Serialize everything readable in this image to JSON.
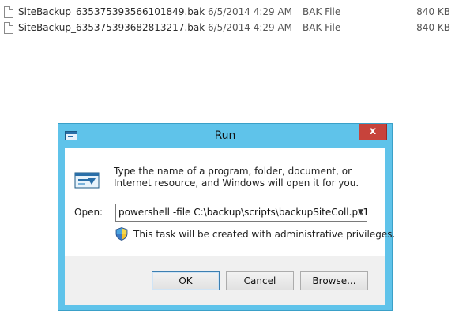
{
  "files": [
    {
      "name": "SiteBackup_635375393566101849.bak",
      "date": "6/5/2014 4:29 AM",
      "type": "BAK File",
      "size": "840 KB"
    },
    {
      "name": "SiteBackup_635375393682813217.bak",
      "date": "6/5/2014 4:29 AM",
      "type": "BAK File",
      "size": "840 KB"
    }
  ],
  "dialog": {
    "title": "Run",
    "close_label": "x",
    "prompt": "Type the name of a program, folder, document, or Internet resource, and Windows will open it for you.",
    "open_label": "Open:",
    "open_value": "powershell -file  C:\\backup\\scripts\\backupSiteColl.ps1",
    "admin_note": "This task will be created with administrative privileges.",
    "ok_label": "OK",
    "cancel_label": "Cancel",
    "browse_label": "Browse..."
  },
  "colors": {
    "titlebar": "#5fc3ea",
    "close_button": "#c7433b",
    "client_bg": "#f0f0f0"
  },
  "icons": {
    "file": "file-icon",
    "run": "run-icon",
    "shield": "uac-shield-icon",
    "dropdown": "chevron-down-icon"
  }
}
